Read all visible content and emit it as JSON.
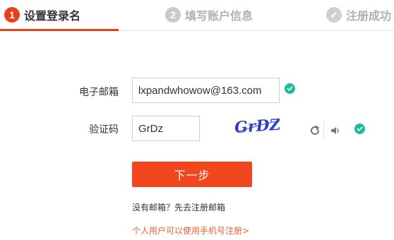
{
  "steps": [
    {
      "number": "1",
      "label": "设置登录名"
    },
    {
      "number": "2",
      "label": "填写账户信息"
    },
    {
      "number": "✓",
      "label": "注册成功"
    }
  ],
  "form": {
    "email_label": "电子邮箱",
    "email_value": "lxpandwhowow@163.com",
    "captcha_label": "验证码",
    "captcha_value": "GrDz",
    "captcha_image_text": "GrDZ"
  },
  "actions": {
    "next_label": "下一步",
    "no_email_text": "没有邮箱？先去注册邮箱",
    "phone_register_link": "个人用户可以使用手机号注册>"
  },
  "colors": {
    "accent": "#f2461e",
    "success": "#1abc9c",
    "inactive": "#c9c9c9",
    "captcha_ink": "#2e3fbf"
  },
  "icons": [
    "check-circle-icon",
    "refresh-icon",
    "speaker-icon"
  ]
}
